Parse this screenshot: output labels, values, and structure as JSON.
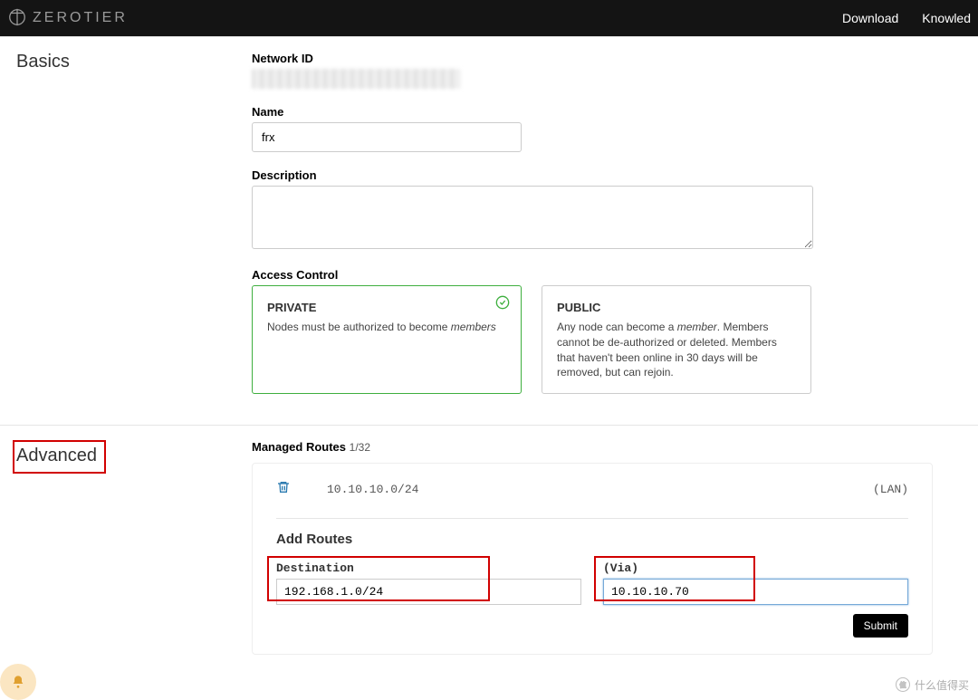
{
  "header": {
    "brand": "ZEROTIER",
    "nav": {
      "download": "Download",
      "knowledge": "Knowled"
    }
  },
  "basics": {
    "title": "Basics",
    "network_id_label": "Network ID",
    "name_label": "Name",
    "name_value": "frx",
    "description_label": "Description",
    "description_value": "",
    "access_control_label": "Access Control",
    "private": {
      "title": "PRIVATE",
      "desc_prefix": "Nodes must be authorized to become ",
      "desc_em": "members"
    },
    "public": {
      "title": "PUBLIC",
      "desc_prefix": "Any node can become a ",
      "desc_em": "member",
      "desc_suffix": ". Members cannot be de-authorized or deleted. Members that haven't been online in 30 days will be removed, but can rejoin."
    }
  },
  "advanced": {
    "title": "Advanced",
    "managed_routes_label": "Managed Routes",
    "managed_routes_count": "1/32",
    "route": {
      "dest": "10.10.10.0/24",
      "tag": "(LAN)"
    },
    "add_routes_title": "Add Routes",
    "destination_label": "Destination",
    "destination_value": "192.168.1.0/24",
    "via_label": "(Via)",
    "via_value": "10.10.10.70",
    "submit": "Submit"
  },
  "watermark": "什么值得买"
}
